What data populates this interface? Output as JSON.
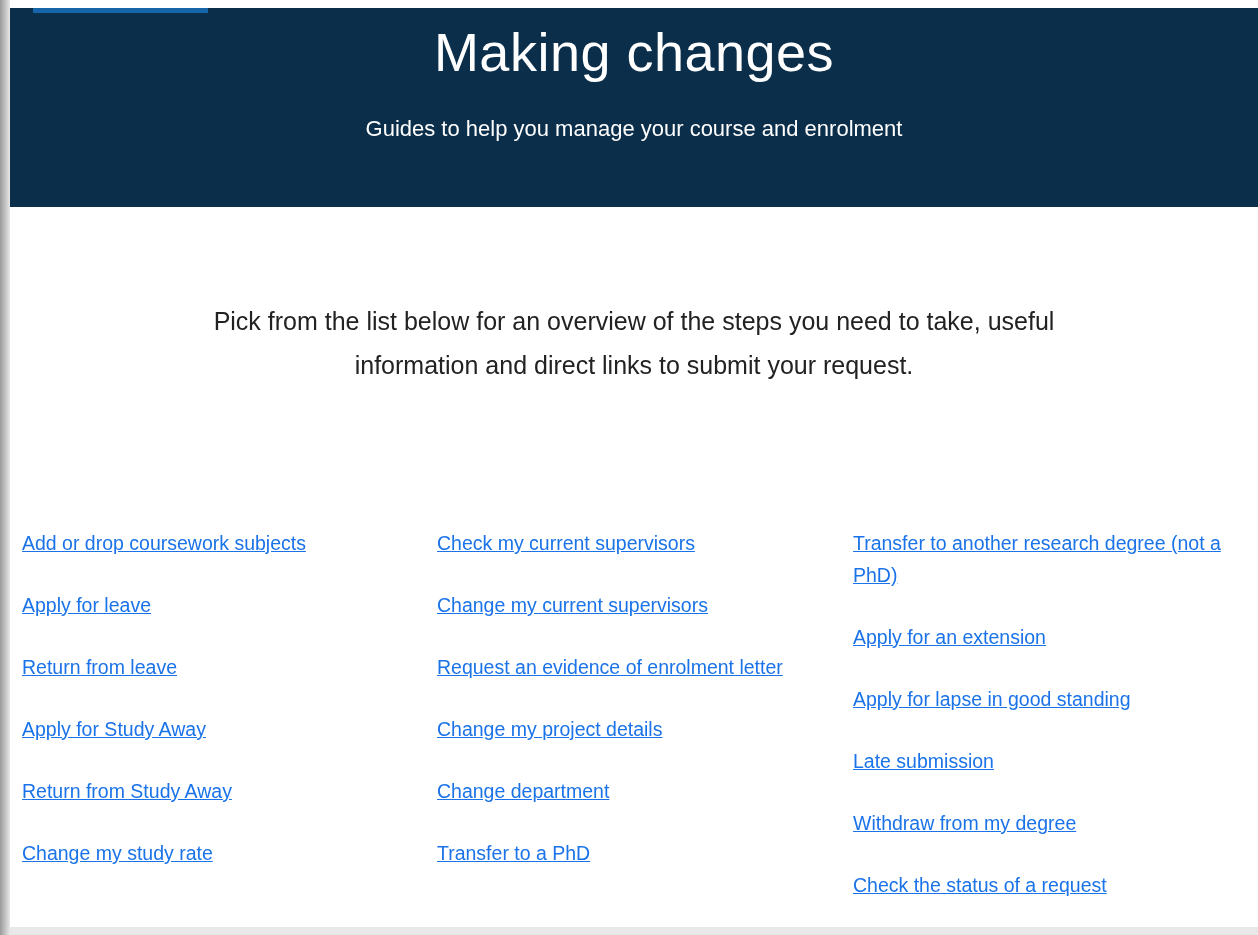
{
  "header": {
    "title": "Making changes",
    "subtitle": "Guides to help you manage your course and enrolment"
  },
  "intro": "Pick from the list below for an overview of the steps you need to take, useful information and direct links to submit your request.",
  "columns": [
    {
      "links": [
        "Add or drop coursework subjects",
        "Apply for leave",
        "Return from leave",
        "Apply for Study Away",
        "Return from Study Away",
        "Change my study rate"
      ]
    },
    {
      "links": [
        "Check my current supervisors",
        "Change my current supervisors",
        "Request an evidence of enrolment letter",
        "Change my project details",
        "Change department",
        "Transfer to a PhD"
      ]
    },
    {
      "links": [
        "Transfer to another research degree (not a PhD)",
        "Apply for an extension",
        "Apply for lapse in good standing",
        "Late submission",
        "Withdraw from my degree",
        "Check the status of a request"
      ]
    }
  ]
}
